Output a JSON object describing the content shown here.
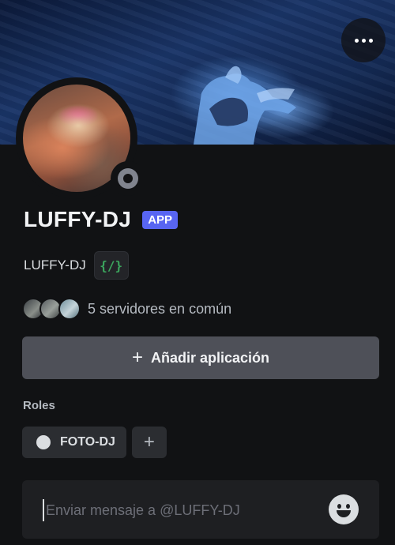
{
  "profile": {
    "display_name": "LUFFY-DJ",
    "app_badge": "APP",
    "username": "LUFFY-DJ",
    "code_badge_glyph": "{/}",
    "status_icon": "offline-status-icon",
    "mutual_servers_text": "5 servidores en común"
  },
  "actions": {
    "add_app_label": "Añadir aplicación",
    "more_icon": "more-horizontal-icon"
  },
  "roles": {
    "title": "Roles",
    "items": [
      {
        "label": "FOTO-DJ",
        "color": "#dbdee1"
      }
    ],
    "add_role_glyph": "+"
  },
  "message": {
    "placeholder": "Enviar mensaje a @LUFFY-DJ",
    "emoji_icon": "emoji-smile-icon"
  },
  "colors": {
    "background": "#111214",
    "accent": "#5865f2",
    "button": "#4e5058",
    "code_badge": "#3ba55d"
  }
}
